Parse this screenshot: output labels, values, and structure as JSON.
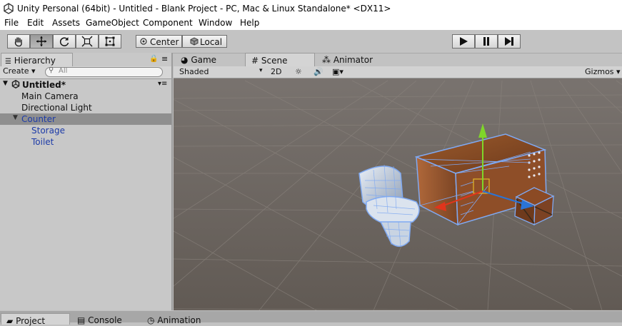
{
  "window": {
    "title": "Unity Personal (64bit) - Untitled - Blank Project - PC, Mac & Linux Standalone* <DX11>"
  },
  "menu": [
    "File",
    "Edit",
    "Assets",
    "GameObject",
    "Component",
    "Window",
    "Help"
  ],
  "toolbar": {
    "tools": [
      "hand-tool",
      "move-tool",
      "rotate-tool",
      "scale-tool",
      "rect-tool"
    ],
    "pivot_mode": "Center",
    "pivot_space": "Local"
  },
  "hierarchy": {
    "tab_label": "Hierarchy",
    "create_label": "Create",
    "search_placeholder": "All",
    "scene_name": "Untitled*",
    "items": [
      {
        "label": "Main Camera"
      },
      {
        "label": "Directional Light"
      },
      {
        "label": "Counter"
      },
      {
        "label": "Storage"
      },
      {
        "label": "Toilet"
      }
    ]
  },
  "center_tabs": [
    "Game",
    "Scene",
    "Animator"
  ],
  "scene_view": {
    "shading_mode": "Shaded",
    "mode_2d": "2D",
    "gizmos_label": "Gizmos"
  },
  "bottom_tabs": [
    "Project",
    "Console",
    "Animation"
  ],
  "colors": {
    "scene_bg": "#655d56",
    "selection_blue": "#7fa9f2",
    "wood": "#8b4a24",
    "gizmo_y": "#7fd62a",
    "gizmo_x": "#e0351c",
    "gizmo_z": "#2b74d6"
  }
}
